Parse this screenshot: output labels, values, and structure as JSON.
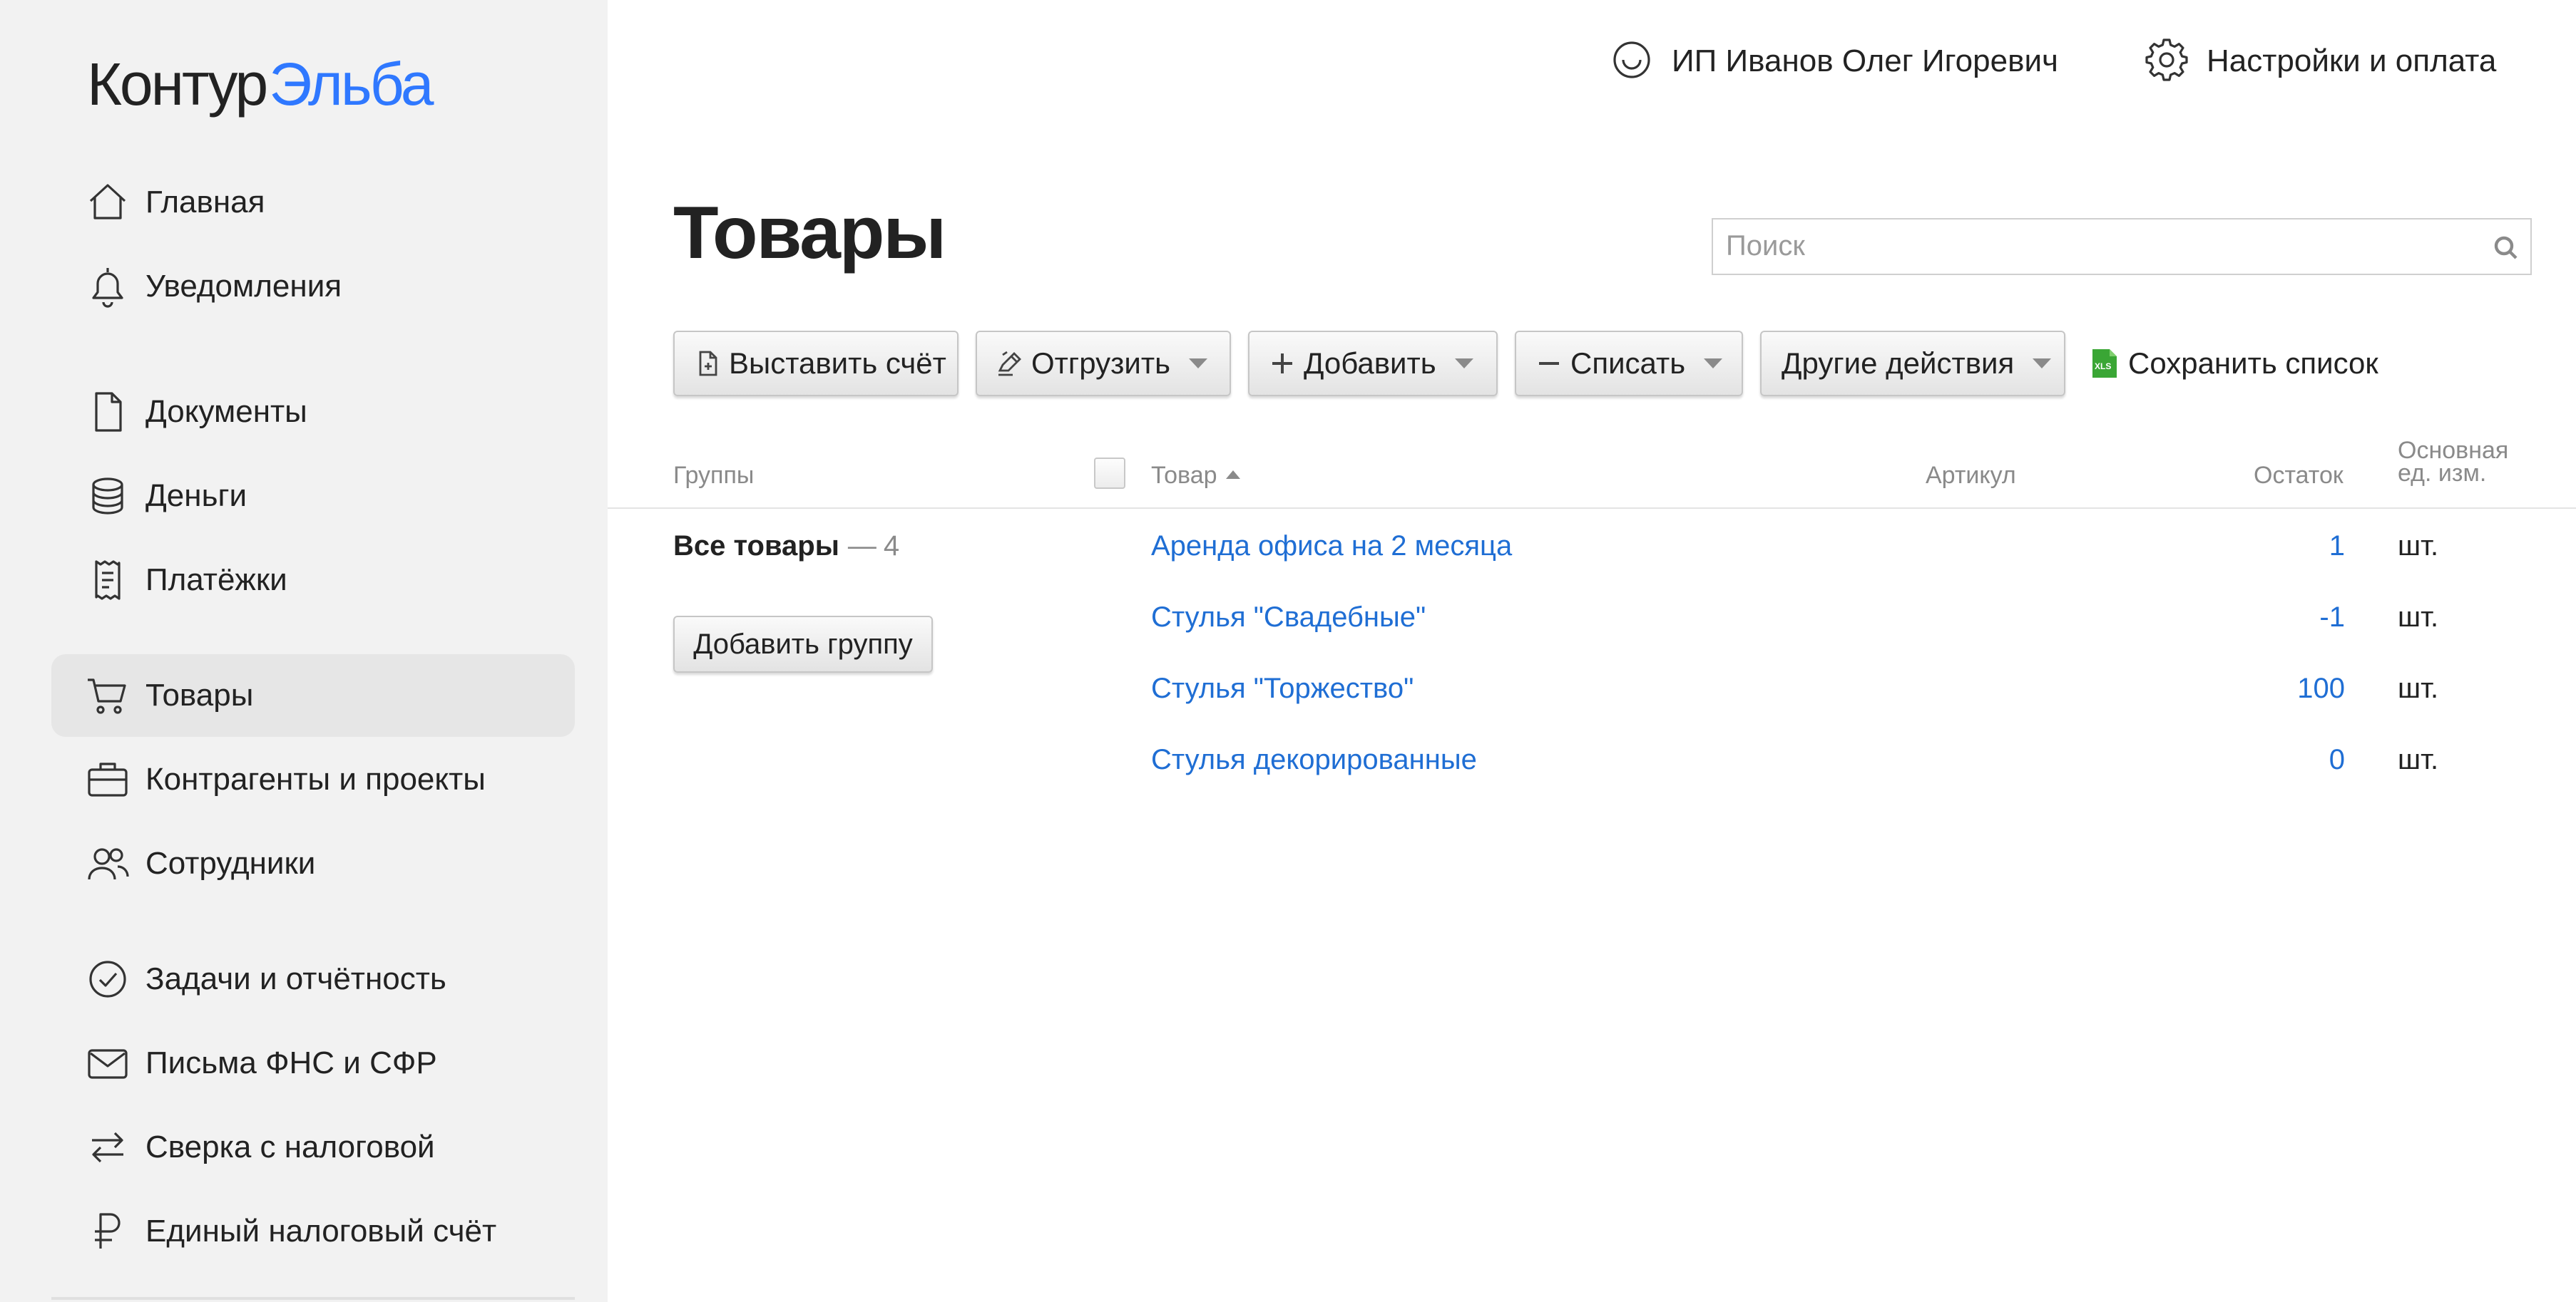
{
  "logo": {
    "part1": "Контур",
    "part2": "Эльба"
  },
  "sidebar": {
    "items": [
      {
        "label": "Главная",
        "icon": "home-icon"
      },
      {
        "label": "Уведомления",
        "icon": "bell-icon"
      },
      {
        "label": "Документы",
        "icon": "document-icon"
      },
      {
        "label": "Деньги",
        "icon": "coins-icon"
      },
      {
        "label": "Платёжки",
        "icon": "receipt-icon"
      },
      {
        "label": "Товары",
        "icon": "cart-icon",
        "active": true
      },
      {
        "label": "Контрагенты и проекты",
        "icon": "briefcase-icon"
      },
      {
        "label": "Сотрудники",
        "icon": "people-icon"
      },
      {
        "label": "Задачи и отчётность",
        "icon": "check-circle-icon"
      },
      {
        "label": "Письма ФНС и СФР",
        "icon": "mail-icon"
      },
      {
        "label": "Сверка с налоговой",
        "icon": "swap-arrows-icon"
      },
      {
        "label": "Единый налоговый счёт",
        "icon": "ruble-icon"
      }
    ]
  },
  "topbar": {
    "user": "ИП Иванов Олег Игоревич",
    "settings": "Настройки и оплата"
  },
  "page": {
    "title": "Товары",
    "search_placeholder": "Поиск"
  },
  "toolbar": {
    "invoice": "Выставить счёт",
    "ship": "Отгрузить",
    "add": "Добавить",
    "writeoff": "Списать",
    "other": "Другие действия",
    "save_list": "Сохранить список",
    "xls_badge": "XLS"
  },
  "table": {
    "headers": {
      "groups": "Группы",
      "product": "Товар",
      "sku": "Артикул",
      "stock": "Остаток",
      "unit_line1": "Основная",
      "unit_line2": "ед. изм."
    },
    "groups": {
      "all_label": "Все товары",
      "dash": "—",
      "all_count": "4",
      "add_group": "Добавить группу"
    },
    "rows": [
      {
        "name": "Аренда офиса на 2 месяца",
        "stock": "1",
        "unit": "шт."
      },
      {
        "name": "Стулья \"Свадебные\"",
        "stock": "-1",
        "unit": "шт."
      },
      {
        "name": "Стулья \"Торжество\"",
        "stock": "100",
        "unit": "шт."
      },
      {
        "name": "Стулья декорированные",
        "stock": "0",
        "unit": "шт."
      }
    ]
  },
  "colors": {
    "brand_blue": "#2f78ff",
    "link_blue": "#1f6ed4",
    "sidebar_bg": "#f2f2f2",
    "xls_green": "#3aa635"
  }
}
